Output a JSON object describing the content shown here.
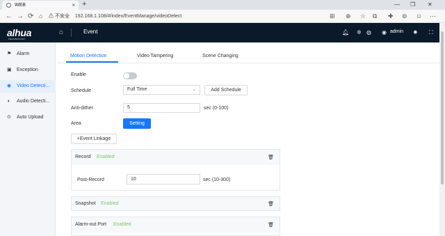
{
  "browser": {
    "tab_title": "WEB",
    "new_tab": "+",
    "tab_close": "×",
    "win_min": "—",
    "win_max": "❐",
    "win_close": "✕",
    "security_warning": "⚠ 不安全",
    "url": "192.168.1.108/#/index/EventManage/videoDetect"
  },
  "header": {
    "logo": "alhua",
    "logo_sub": "TECHNOLOGY",
    "title": "Event",
    "user": "admin"
  },
  "sidebar": {
    "items": [
      {
        "label": "Alarm",
        "icon": "alarm-icon"
      },
      {
        "label": "Exception",
        "icon": "exception-icon"
      },
      {
        "label": "Video Detecti...",
        "icon": "video-icon"
      },
      {
        "label": "Audio Detecti...",
        "icon": "audio-icon"
      },
      {
        "label": "Auto Upload",
        "icon": "upload-icon"
      }
    ],
    "active_index": 2
  },
  "tabs": {
    "motion": "Motion Detection",
    "tampering": "Video Tampering",
    "scene": "Scene Changing"
  },
  "form": {
    "enable_label": "Enable",
    "enable_on": false,
    "schedule_label": "Schedule",
    "schedule_value": "Full Time",
    "add_schedule": "Add Schedule",
    "antidither_label": "Anti-dither",
    "antidither_value": "5",
    "antidither_unit": "sec (0-100)",
    "area_label": "Area",
    "setting_button": "Setting",
    "event_linkage": "+Event Linkage"
  },
  "panels": {
    "record": {
      "title": "Record",
      "status": "Enabled",
      "postrecord_label": "Post-Record",
      "postrecord_value": "10",
      "postrecord_unit": "sec (10-300)"
    },
    "snapshot": {
      "title": "Snapshot",
      "status": "Enabled"
    },
    "alarmout": {
      "title": "Alarm-out Port",
      "status": "Enabled"
    }
  },
  "colors": {
    "accent": "#1677ff",
    "header_bg": "#0b1a2b",
    "enabled_green": "#7cc36b"
  }
}
